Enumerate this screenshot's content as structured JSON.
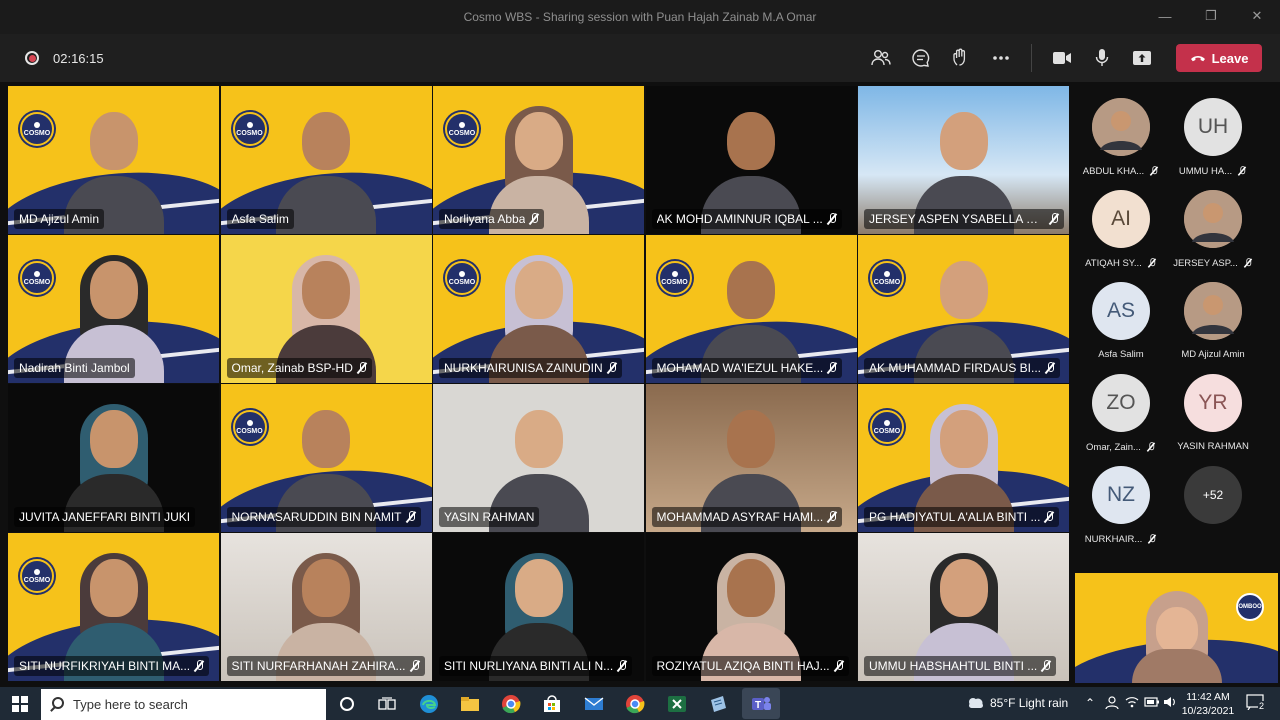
{
  "window": {
    "title": "Cosmo WBS - Sharing session with Puan Hajah Zainab M.A Omar",
    "controls": [
      "minimize-icon",
      "restore-icon",
      "close-icon"
    ]
  },
  "toolbar": {
    "recording_timer": "02:16:15",
    "icons": [
      "participants-icon",
      "chat-icon",
      "raise-hand-icon",
      "more-options-icon",
      "camera-icon",
      "microphone-icon",
      "share-screen-icon"
    ],
    "leave_label": "Leave",
    "leave_color": "#c4314b"
  },
  "video_grid": [
    {
      "name": "MD Ajizul Amin",
      "bg": "cosmo",
      "muted": false
    },
    {
      "name": "Asfa Salim",
      "bg": "cosmo",
      "muted": false
    },
    {
      "name": "Norliyana  Abba",
      "bg": "cosmo",
      "muted": true
    },
    {
      "name": "AK MOHD AMINNUR IQBAL ...",
      "bg": "dark",
      "muted": true
    },
    {
      "name": "JERSEY ASPEN YSABELLA BU...",
      "bg": "sky",
      "muted": true
    },
    {
      "name": "Nadirah Binti Jambol",
      "bg": "cosmo",
      "muted": false
    },
    {
      "name": "Omar, Zainab BSP-HD",
      "bg": "yellow-plain",
      "muted": true
    },
    {
      "name": "NURKHAIRUNISA ZAINUDIN",
      "bg": "cosmo",
      "muted": true
    },
    {
      "name": "MOHAMAD WA'IEZUL HAKE...",
      "bg": "cosmo",
      "muted": true
    },
    {
      "name": "AK MUHAMMAD FIRDAUS BI...",
      "bg": "cosmo",
      "muted": true
    },
    {
      "name": "JUVITA JANEFFARI BINTI JUKI",
      "bg": "dark",
      "muted": false
    },
    {
      "name": "NORNASARUDDIN BIN NAMIT",
      "bg": "cosmo",
      "muted": true
    },
    {
      "name": "YASIN RAHMAN",
      "bg": "light",
      "muted": false
    },
    {
      "name": "MOHAMMAD ASYRAF HAMI...",
      "bg": "cafe",
      "muted": true
    },
    {
      "name": "PG HADIYATUL A'ALIA BINTI ...",
      "bg": "cosmo",
      "muted": true
    },
    {
      "name": "SITI NURFIKRIYAH BINTI MA...",
      "bg": "cosmo",
      "muted": true
    },
    {
      "name": "SITI NURFARHANAH ZAHIRA...",
      "bg": "room",
      "muted": true
    },
    {
      "name": "SITI NURLIYANA BINTI ALI N...",
      "bg": "dark",
      "muted": true
    },
    {
      "name": "ROZIYATUL AZIQA BINTI HAJ...",
      "bg": "dark",
      "muted": true
    },
    {
      "name": "UMMU HABSHAHTUL BINTI ...",
      "bg": "room",
      "muted": true
    }
  ],
  "tile_logo_text": "COSMO",
  "roster": [
    {
      "initials": "",
      "name": "ABDUL KHA...",
      "style": "photo",
      "muted": true
    },
    {
      "initials": "UH",
      "name": "UMMU HA...",
      "style": "gray",
      "muted": true
    },
    {
      "initials": "AI",
      "name": "ATIQAH SY...",
      "style": "peach",
      "muted": true
    },
    {
      "initials": "",
      "name": "JERSEY ASP...",
      "style": "photo",
      "muted": true
    },
    {
      "initials": "AS",
      "name": "Asfa Salim",
      "style": "blue",
      "muted": false
    },
    {
      "initials": "",
      "name": "MD Ajizul Amin",
      "style": "photo",
      "muted": false
    },
    {
      "initials": "ZO",
      "name": "Omar, Zain...",
      "style": "gray",
      "muted": true
    },
    {
      "initials": "YR",
      "name": "YASIN RAHMAN",
      "style": "pink",
      "muted": false
    },
    {
      "initials": "NZ",
      "name": "NURKHAIR...",
      "style": "blue",
      "muted": true
    },
    {
      "initials": "+52",
      "name": "",
      "style": "more",
      "muted": false
    }
  ],
  "self_view_logo_text": "OMBOO",
  "taskbar": {
    "search_placeholder": "Type here to search",
    "weather": "85°F  Light rain",
    "time": "11:42 AM",
    "date": "10/23/2021",
    "notification_count": "2"
  }
}
